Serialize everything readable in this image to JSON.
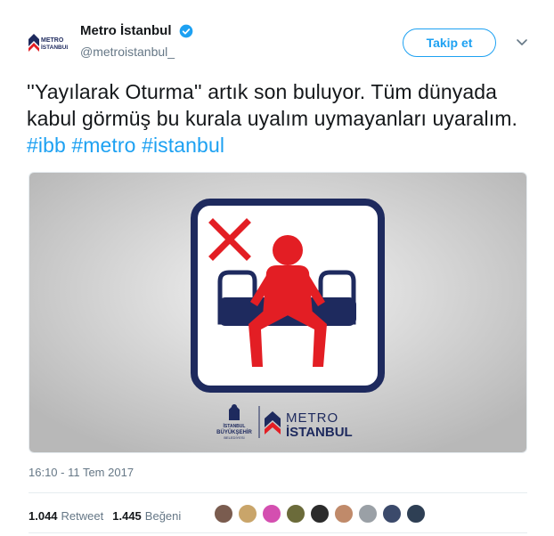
{
  "account": {
    "display_name": "Metro İstanbul",
    "handle": "@metroistanbul_",
    "avatar_icon": "metro-istanbul-logo-icon",
    "avatar_logo_line1": "METRO",
    "avatar_logo_line2": "İSTANBUL",
    "verified_icon": "verified-badge-icon"
  },
  "actions": {
    "follow_label": "Takip et",
    "more_icon": "chevron-down-icon"
  },
  "tweet": {
    "text_part1": "''Yayılarak Oturma'' artık son buluyor. Tüm dünyada kabul görmüş bu kurala uyalım uymayanları uyaralım.",
    "hashtags": [
      "#ibb",
      "#metro",
      "#istanbul"
    ]
  },
  "media": {
    "description_icon": "no-manspreading-sign-icon",
    "logo_ibb_line1": "İSTANBUL",
    "logo_ibb_line2": "BÜYÜKŞEHİR",
    "logo_ibb_line3": "BELEDİYESİ",
    "logo_metro_line1": "METRO",
    "logo_metro_line2": "İSTANBUL"
  },
  "timestamp": "16:10 - 11 Tem 2017",
  "stats": {
    "retweet_count": "1.044",
    "retweet_label": "Retweet",
    "like_count": "1.445",
    "like_label": "Beğeni"
  },
  "likers": [
    {
      "color": "#7a5c4f"
    },
    {
      "color": "#c9a56a"
    },
    {
      "color": "#d44fb0"
    },
    {
      "color": "#6b6b3a"
    },
    {
      "color": "#2b2b2b"
    },
    {
      "color": "#c08a6a"
    },
    {
      "color": "#9aa0a6"
    },
    {
      "color": "#3b4a6b"
    },
    {
      "color": "#2e3f54"
    }
  ],
  "colors": {
    "accent": "#1da1f2",
    "sign_navy": "#1e2a5e",
    "sign_red": "#e31e24"
  }
}
